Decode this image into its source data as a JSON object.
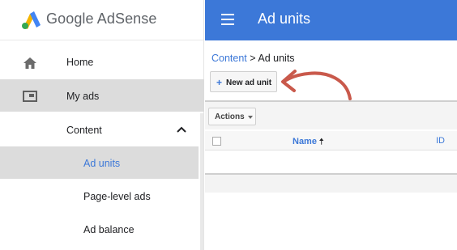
{
  "app": {
    "logo_text": "Google AdSense"
  },
  "sidebar": {
    "items": [
      {
        "label": "Home",
        "icon": "home-icon"
      },
      {
        "label": "My ads",
        "icon": "ad-unit-icon"
      },
      {
        "label": "Content",
        "icon": "chevron-up-icon"
      }
    ],
    "subitems": [
      {
        "label": "Ad units",
        "selected": true
      },
      {
        "label": "Page-level ads"
      },
      {
        "label": "Ad balance"
      }
    ]
  },
  "header": {
    "title": "Ad units",
    "menu_icon": "hamburger-icon"
  },
  "breadcrumb": {
    "parent": "Content",
    "separator": ">",
    "current": "Ad units"
  },
  "toolbar": {
    "new_ad_unit": "New ad unit",
    "actions": "Actions"
  },
  "table": {
    "columns": [
      "Name",
      "ID"
    ],
    "sort_column": "Name",
    "sort_dir": "ascending"
  },
  "colors": {
    "brand_blue": "#3c78d8",
    "arrow_red": "#c9594b",
    "selected_bg": "#dcdcdc"
  }
}
